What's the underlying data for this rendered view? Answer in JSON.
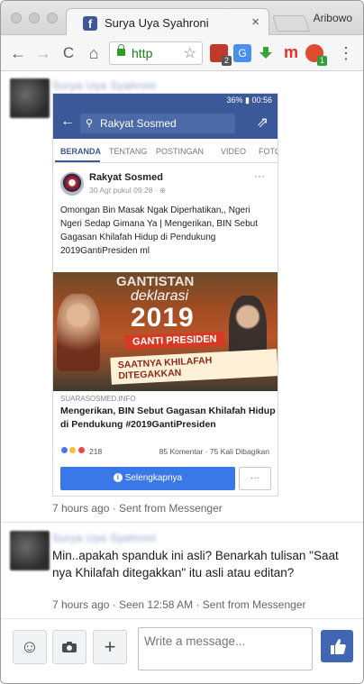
{
  "tab": {
    "title": "Surya Uya Syahroni",
    "close": "×",
    "favicon_letter": "f"
  },
  "profile": "Aribowo",
  "toolbar": {
    "url": "http",
    "back": "←",
    "forward": "→",
    "reload": "C",
    "home": "⌂",
    "menu": "⋮",
    "star": "☆",
    "extensions": [
      {
        "name": "shield-extension",
        "color": "#c0392b",
        "badge": "2"
      },
      {
        "name": "translate-extension",
        "color": "#4a8ef0",
        "badge": ""
      },
      {
        "name": "download-extension",
        "color": "#3aa33a",
        "badge": ""
      },
      {
        "name": "m-extension",
        "color": "#e0332f",
        "badge": "",
        "text": "m"
      },
      {
        "name": "notification-extension",
        "color": "#e04a2f",
        "badge": "1"
      }
    ]
  },
  "message1": {
    "sender": "Surya Uya Syahroni",
    "meta": "7 hours ago · Sent from Messenger"
  },
  "screenshot": {
    "status_right": "36% ▮ 00:56",
    "search_text": "Rakyat Sosmed",
    "tabs": [
      "BERANDA",
      "TENTANG",
      "POSTINGAN",
      "VIDEO",
      "FOTO"
    ],
    "page_name": "Rakyat Sosmed",
    "post_time": "30 Agt pukul 09:28 · ⊕",
    "post_more": "···",
    "post_body": "Omongan Bin Masak Ngak Diperhatikan,, Ngeri Ngeri Sedap Gimana Ya | Mengerikan, BIN Sebut Gagasan Khilafah Hidup di Pendukung 2019GantiPresiden ml",
    "banner": {
      "line1": "GANTISTAN",
      "line2": "deklarasi",
      "line3": "2019",
      "line4": "GANTI PRESIDEN",
      "line5": "SAATNYA KHILAFAH DITEGAKKAN"
    },
    "link_source": "SUARASOSMED.INFO",
    "link_title": "Mengerikan, BIN Sebut Gagasan Khilafah Hidup di Pendukung #2019GantiPresiden",
    "reaction_count": "218",
    "comments_shares": "85 Komentar · 75 Kali Dibagikan",
    "button_label": "Selengkapnya",
    "button_more": "···"
  },
  "message2": {
    "sender": "Surya Uya Syahroni",
    "text": "Min..apakah spanduk ini asli? Benarkah tulisan \"Saat nya Khilafah ditegakkan\" itu asli atau editan?",
    "meta": "7 hours ago · Seen 12:58 AM · Sent from Messenger"
  },
  "composer": {
    "placeholder": "Write a message...",
    "emoji": "☺",
    "camera": "◙",
    "plus": "+"
  },
  "colors": {
    "facebook_blue": "#3b5998",
    "messenger_blue": "#4267b2"
  }
}
